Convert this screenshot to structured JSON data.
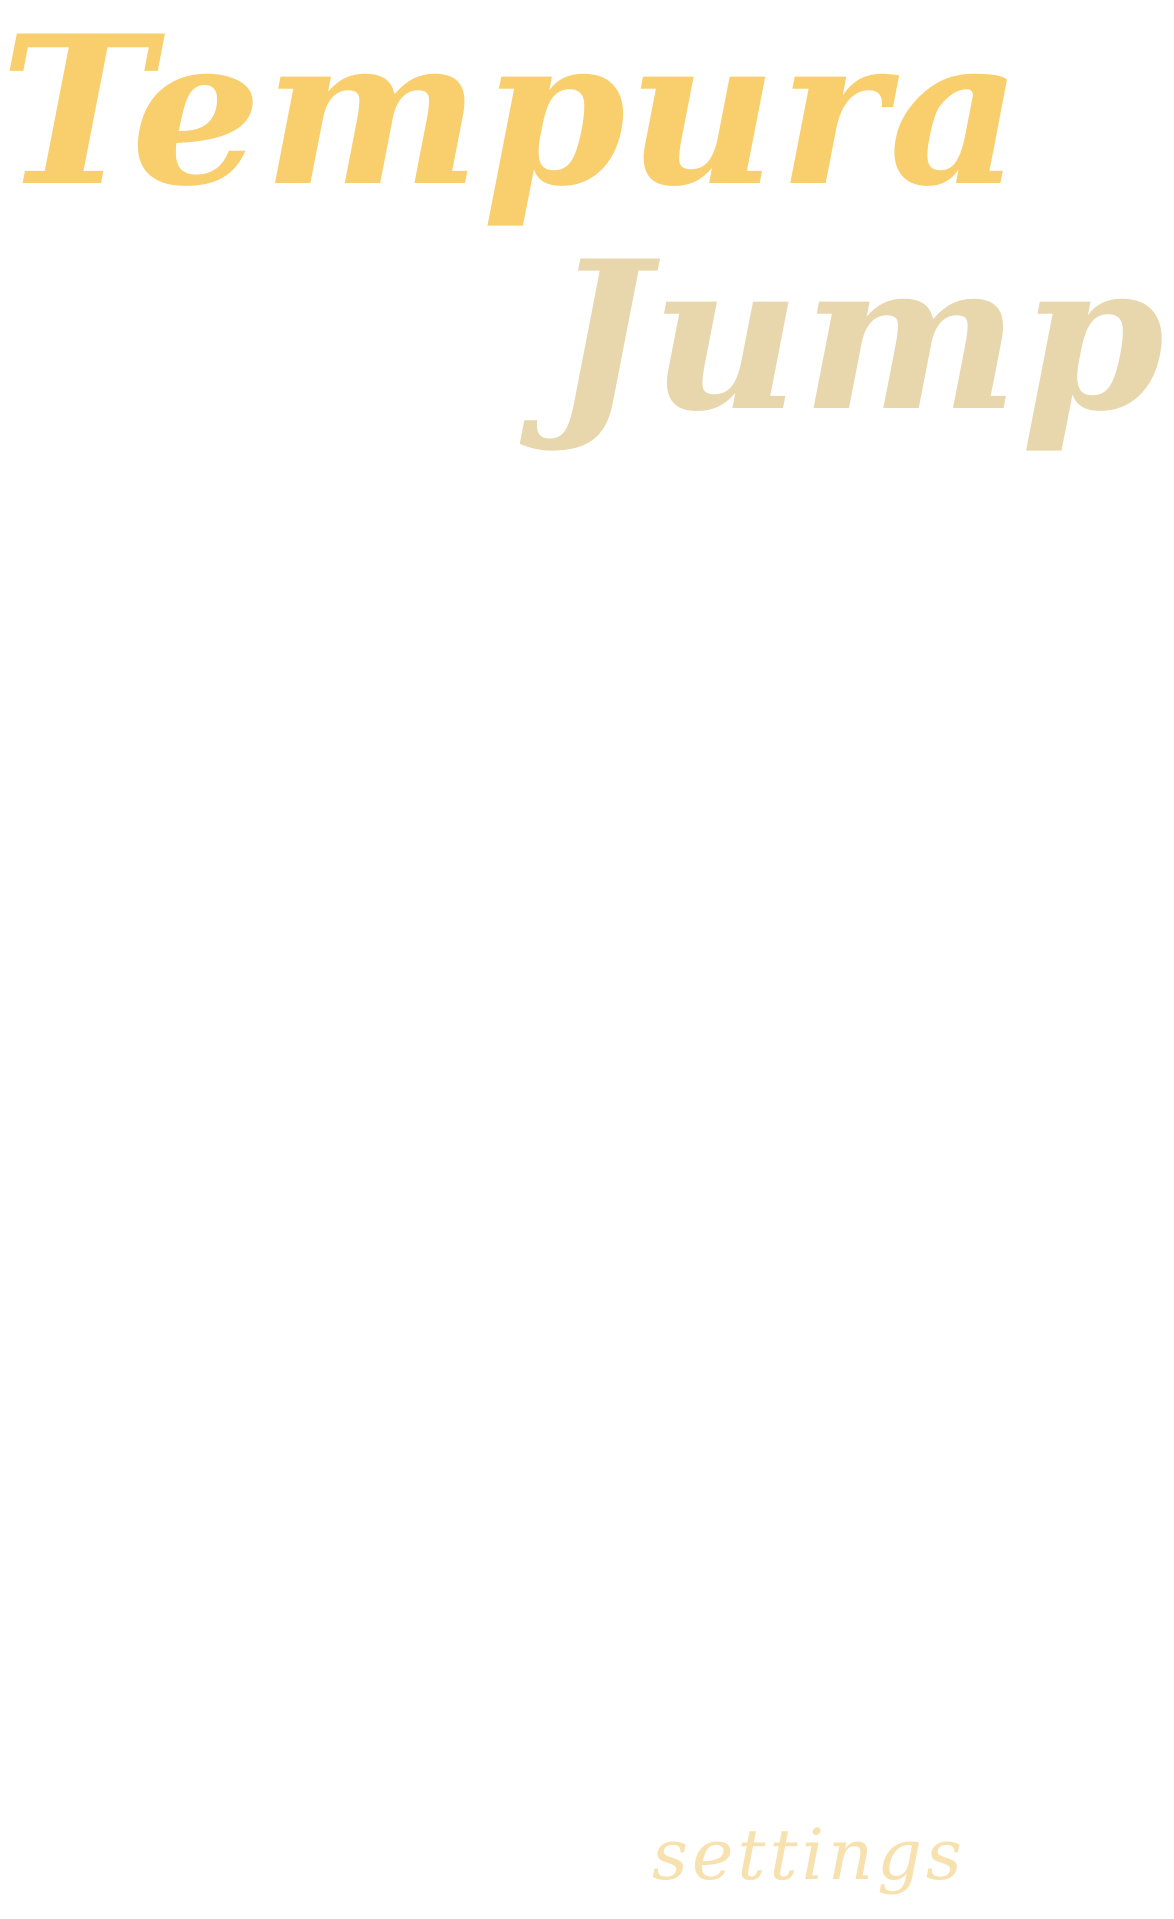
{
  "title": {
    "line1": "Tempura",
    "line2": "Jump"
  },
  "menu": {
    "settings_label": "settings"
  },
  "colors": {
    "background": "#ffffff",
    "title_line1": "#f9cf6e",
    "title_line2": "#e8d6ad",
    "settings": "#f7e1ae"
  }
}
